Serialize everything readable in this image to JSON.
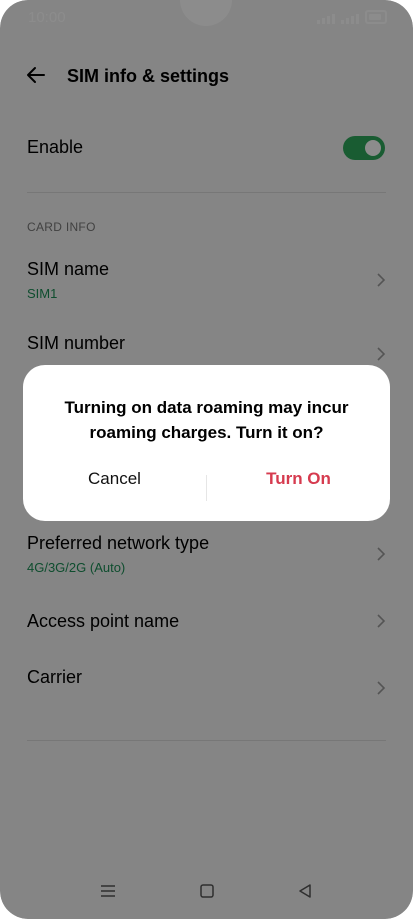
{
  "status_bar": {
    "time": "10:00"
  },
  "header": {
    "title": "SIM info & settings"
  },
  "settings": {
    "enable_label": "Enable",
    "enable_on": true,
    "section_card_info": "CARD INFO",
    "sim_name_label": "SIM name",
    "sim_name_value": "SIM1",
    "sim_number_label": "SIM number",
    "preferred_network_label": "Preferred network type",
    "preferred_network_value": "4G/3G/2G (Auto)",
    "apn_label": "Access point name",
    "carrier_label": "Carrier"
  },
  "dialog": {
    "message": "Turning on data roaming may incur roaming charges. Turn it on?",
    "cancel_label": "Cancel",
    "confirm_label": "Turn On",
    "confirm_color": "#d63b4f"
  },
  "colors": {
    "accent_green": "#2fa85b",
    "subtext_green": "#1a8d55"
  },
  "icons": {
    "back": "arrow-left-icon",
    "chevron": "chevron-right-icon",
    "nav_menu": "menu-icon",
    "nav_home": "square-icon",
    "nav_back": "triangle-back-icon"
  }
}
